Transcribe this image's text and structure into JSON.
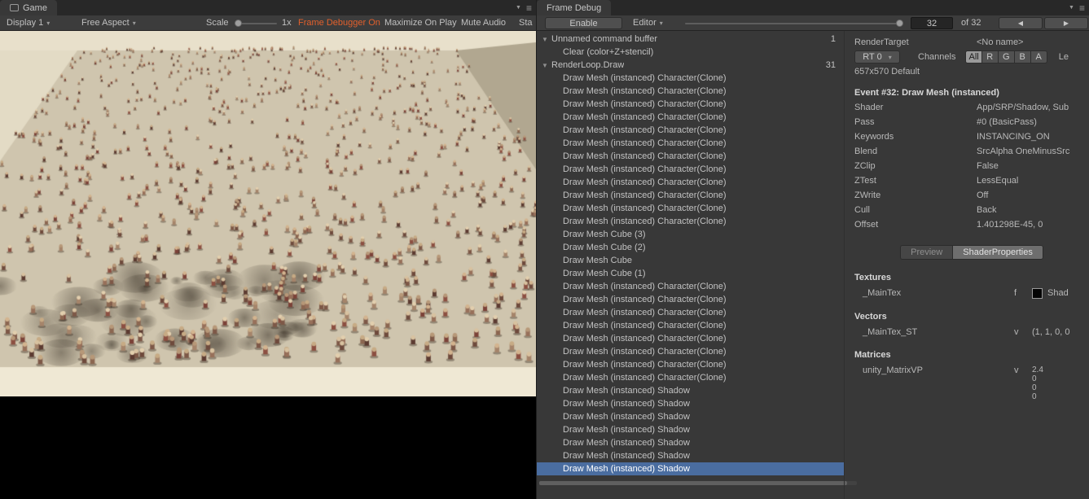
{
  "icons": {
    "menu": "≡",
    "dropdown": "▾",
    "window_dropdown": "▼",
    "prev": "◀",
    "next": "▶",
    "tri_expanded": "▼"
  },
  "game_panel": {
    "tab": "Game",
    "toolbar": {
      "display": "Display 1",
      "aspect": "Free Aspect",
      "scale_label": "Scale",
      "scale_value": "1x",
      "frame_debugger": "Frame Debugger On",
      "maximize": "Maximize On Play",
      "mute": "Mute Audio",
      "stats": "Sta"
    }
  },
  "game_view": {
    "colors": {
      "floor": "#cfc5ae",
      "wall_back": "#e8e0cb",
      "wall_left": "#e3dbc5",
      "wall_right": "#b1a790",
      "floor_front": "#efe8d4"
    },
    "body_colors": [
      "#6e4a3c",
      "#7d5847",
      "#5c3b31",
      "#8b6650",
      "#97705a",
      "#7b4238",
      "#a5846a",
      "#8c4f41"
    ],
    "head_colors": [
      "#d8c2a0",
      "#c7ab85",
      "#e2cfae",
      "#b79878",
      "#d3b48f"
    ]
  },
  "frame_debug": {
    "tab": "Frame Debug",
    "toolbar": {
      "enable": "Enable",
      "target": "Editor",
      "current_event": "32",
      "of_total": "of 32"
    },
    "tree": [
      {
        "label": "Unnamed command buffer",
        "level": 0,
        "expanded": true,
        "count": "1"
      },
      {
        "label": "Clear (color+Z+stencil)",
        "level": 1
      },
      {
        "label": "RenderLoop.Draw",
        "level": 0,
        "expanded": true,
        "count": "31"
      },
      {
        "label": "Draw Mesh (instanced) Character(Clone)",
        "level": 1
      },
      {
        "label": "Draw Mesh (instanced) Character(Clone)",
        "level": 1
      },
      {
        "label": "Draw Mesh (instanced) Character(Clone)",
        "level": 1
      },
      {
        "label": "Draw Mesh (instanced) Character(Clone)",
        "level": 1
      },
      {
        "label": "Draw Mesh (instanced) Character(Clone)",
        "level": 1
      },
      {
        "label": "Draw Mesh (instanced) Character(Clone)",
        "level": 1
      },
      {
        "label": "Draw Mesh (instanced) Character(Clone)",
        "level": 1
      },
      {
        "label": "Draw Mesh (instanced) Character(Clone)",
        "level": 1
      },
      {
        "label": "Draw Mesh (instanced) Character(Clone)",
        "level": 1
      },
      {
        "label": "Draw Mesh (instanced) Character(Clone)",
        "level": 1
      },
      {
        "label": "Draw Mesh (instanced) Character(Clone)",
        "level": 1
      },
      {
        "label": "Draw Mesh (instanced) Character(Clone)",
        "level": 1
      },
      {
        "label": "Draw Mesh Cube (3)",
        "level": 1
      },
      {
        "label": "Draw Mesh Cube (2)",
        "level": 1
      },
      {
        "label": "Draw Mesh Cube",
        "level": 1
      },
      {
        "label": "Draw Mesh Cube (1)",
        "level": 1
      },
      {
        "label": "Draw Mesh (instanced) Character(Clone)",
        "level": 1
      },
      {
        "label": "Draw Mesh (instanced) Character(Clone)",
        "level": 1
      },
      {
        "label": "Draw Mesh (instanced) Character(Clone)",
        "level": 1
      },
      {
        "label": "Draw Mesh (instanced) Character(Clone)",
        "level": 1
      },
      {
        "label": "Draw Mesh (instanced) Character(Clone)",
        "level": 1
      },
      {
        "label": "Draw Mesh (instanced) Character(Clone)",
        "level": 1
      },
      {
        "label": "Draw Mesh (instanced) Character(Clone)",
        "level": 1
      },
      {
        "label": "Draw Mesh (instanced) Character(Clone)",
        "level": 1
      },
      {
        "label": "Draw Mesh (instanced) Shadow",
        "level": 1
      },
      {
        "label": "Draw Mesh (instanced) Shadow",
        "level": 1
      },
      {
        "label": "Draw Mesh (instanced) Shadow",
        "level": 1
      },
      {
        "label": "Draw Mesh (instanced) Shadow",
        "level": 1
      },
      {
        "label": "Draw Mesh (instanced) Shadow",
        "level": 1
      },
      {
        "label": "Draw Mesh (instanced) Shadow",
        "level": 1
      },
      {
        "label": "Draw Mesh (instanced) Shadow",
        "level": 1,
        "selected": true
      }
    ],
    "details": {
      "render_target_label": "RenderTarget",
      "render_target_value": "<No name>",
      "rt_dropdown": "RT 0",
      "channels_label": "Channels",
      "channels": [
        "All",
        "R",
        "G",
        "B",
        "A"
      ],
      "channels_selected": "All",
      "levels_label": "Le",
      "size_info": "657x570 Default",
      "event_title": "Event #32: Draw Mesh (instanced)",
      "properties": [
        {
          "key": "Shader",
          "value": "App/SRP/Shadow, Sub"
        },
        {
          "key": "Pass",
          "value": "#0 (BasicPass)"
        },
        {
          "key": "Keywords",
          "value": "INSTANCING_ON"
        },
        {
          "key": "Blend",
          "value": "SrcAlpha OneMinusSrc"
        },
        {
          "key": "ZClip",
          "value": "False"
        },
        {
          "key": "ZTest",
          "value": "LessEqual"
        },
        {
          "key": "ZWrite",
          "value": "Off"
        },
        {
          "key": "Cull",
          "value": "Back"
        },
        {
          "key": "Offset",
          "value": "1.401298E-45, 0"
        }
      ],
      "tabs": [
        "Preview",
        "ShaderProperties"
      ],
      "textures": {
        "title": "Textures",
        "rows": [
          {
            "name": "_MainTex",
            "type": "f",
            "value": "Shad"
          }
        ]
      },
      "vectors": {
        "title": "Vectors",
        "rows": [
          {
            "name": "_MainTex_ST",
            "type": "v",
            "value": "(1, 1, 0, 0"
          }
        ]
      },
      "matrices": {
        "title": "Matrices",
        "rows": [
          {
            "name": "unity_MatrixVP",
            "type": "v",
            "value": "2.4\n0\n0\n0"
          }
        ]
      }
    }
  }
}
